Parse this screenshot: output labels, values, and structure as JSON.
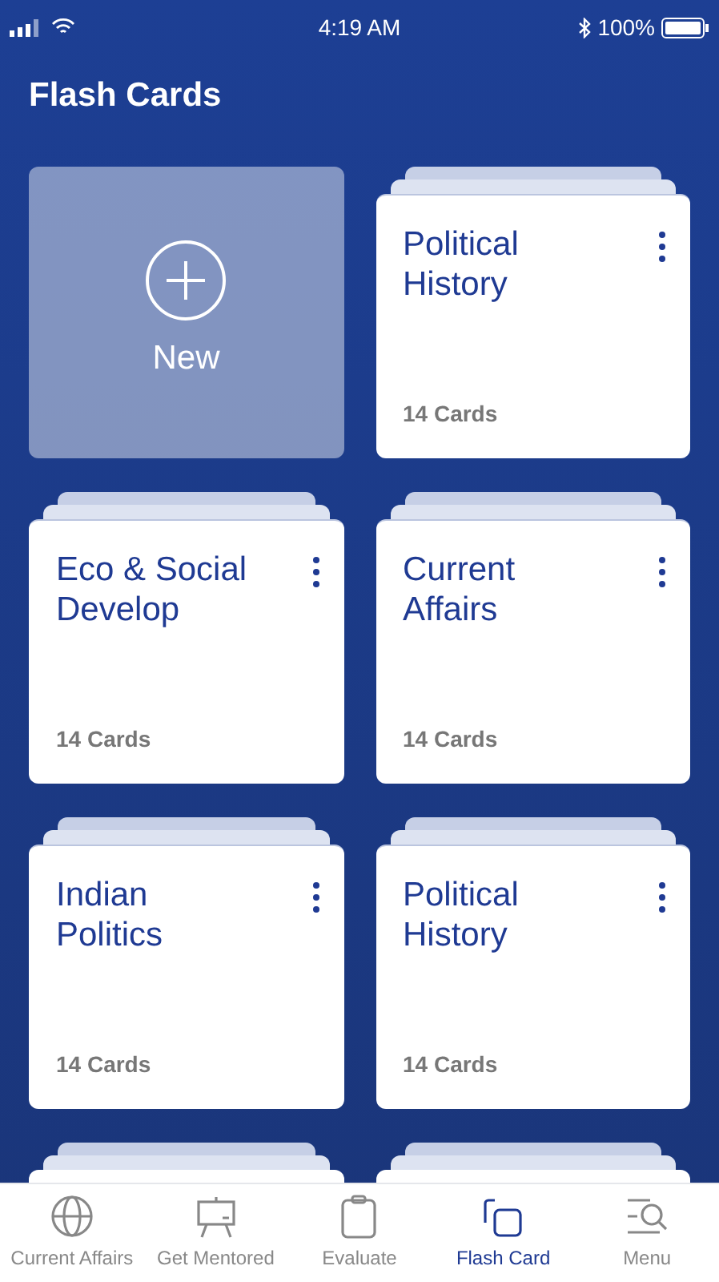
{
  "status_bar": {
    "time": "4:19 AM",
    "battery": "100%"
  },
  "title": "Flash Cards",
  "new_tile": {
    "label": "New"
  },
  "decks": [
    {
      "title": "Political History",
      "count": "14 Cards"
    },
    {
      "title": "Eco & Social Develop",
      "count": "14 Cards"
    },
    {
      "title": "Current Affairs",
      "count": "14 Cards"
    },
    {
      "title": "Indian Politics",
      "count": "14 Cards"
    },
    {
      "title": "Political History",
      "count": "14 Cards"
    }
  ],
  "tabs": [
    {
      "label": "Current Affairs",
      "kind": "globe",
      "selected": false
    },
    {
      "label": "Get Mentored",
      "kind": "board",
      "selected": false
    },
    {
      "label": "Evaluate",
      "kind": "clipboard",
      "selected": false
    },
    {
      "label": "Flash Card",
      "kind": "cards",
      "selected": true
    },
    {
      "label": "Menu",
      "kind": "menu",
      "selected": false
    }
  ]
}
